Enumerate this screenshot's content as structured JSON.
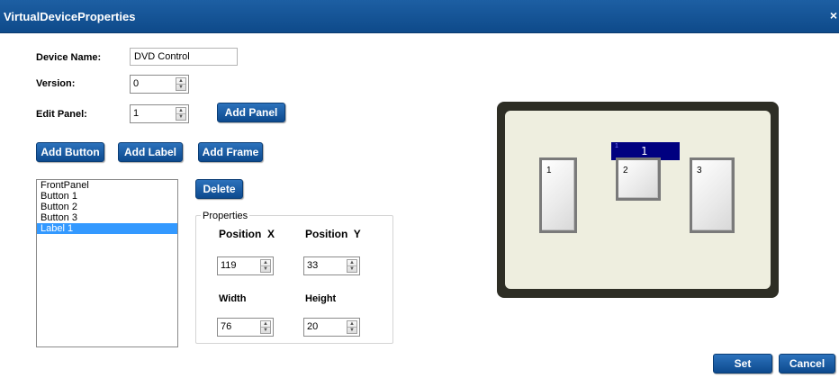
{
  "window": {
    "title": "VirtualDeviceProperties",
    "close_glyph": "×"
  },
  "form": {
    "device_name_label": "Device Name:",
    "device_name_value": "DVD Control",
    "version_label": "Version:",
    "version_value": "0",
    "edit_panel_label": "Edit Panel:",
    "edit_panel_value": "1"
  },
  "buttons": {
    "add_panel": "Add Panel",
    "add_button": "Add Button",
    "add_label": "Add Label",
    "add_frame": "Add Frame",
    "delete": "Delete",
    "set": "Set",
    "cancel": "Cancel"
  },
  "element_list": {
    "items": [
      "FrontPanel",
      "Button 1",
      "Button 2",
      "Button 3",
      "Label 1"
    ],
    "selected": "Label 1"
  },
  "properties": {
    "legend": "Properties",
    "position_x_label": "Position  X",
    "position_y_label": "Position  Y",
    "width_label": "Width",
    "height_label": "Height",
    "position_x_value": "119",
    "position_y_value": "33",
    "width_value": "76",
    "height_value": "20"
  },
  "preview": {
    "label": {
      "index": "1",
      "text": "1"
    },
    "buttons": [
      "1",
      "2",
      "3"
    ]
  },
  "icons": {
    "spin_up": "spinner-up-icon",
    "spin_down": "spinner-down-icon",
    "close": "close-icon"
  },
  "colors": {
    "title_bar": "#1a5a9e",
    "button": "#1a5fa6",
    "selection": "#3399ff",
    "preview_frame": "#2e2e25",
    "preview_panel": "#eeeedf",
    "preview_label": "#000080"
  }
}
